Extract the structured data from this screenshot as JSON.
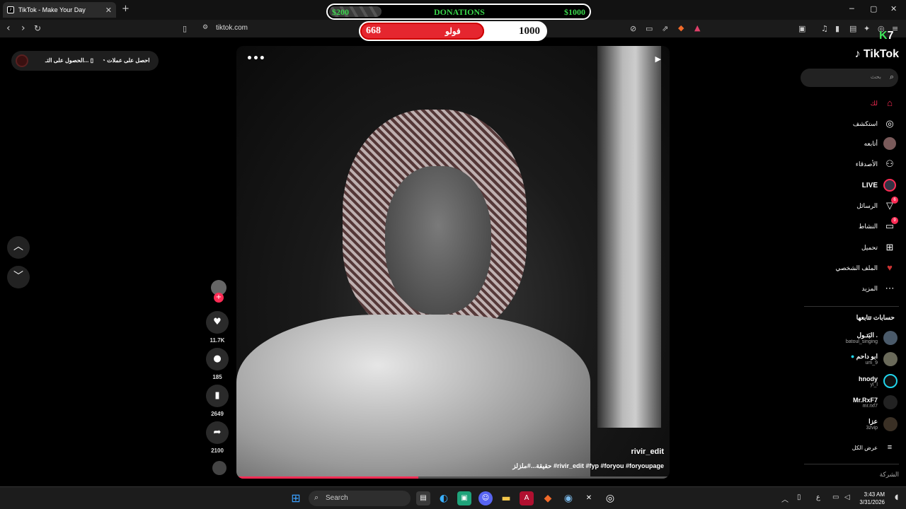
{
  "browser": {
    "tab_title": "TikTok - Make Your Day",
    "tab_close": "✕",
    "new_tab": "+",
    "url": "tiktok.com",
    "window_controls": [
      "─",
      "▢",
      "✕"
    ]
  },
  "overlay": {
    "donations": {
      "left_value": "$200",
      "title": "DONATIONS",
      "right_value": "$1000"
    },
    "followers": {
      "current": "668",
      "label": "فولو",
      "goal": "1000",
      "progress": 0.668
    },
    "corner_logo": "7"
  },
  "promo": {
    "item1": "احصل على عملات",
    "item2": "الحصول على التـ..."
  },
  "video": {
    "username": "rivir_edit",
    "caption": "حقيقة...#ملزلز #rivir_edit #fyp #foryou #foryoupage",
    "progress": 0.42
  },
  "actions": {
    "likes": "11.7K",
    "comments": "185",
    "saves": "2649",
    "shares": "2100"
  },
  "sidebar": {
    "logo": "TikTok",
    "search_placeholder": "بحث",
    "nav": [
      {
        "label": "لك",
        "icon": "home-icon"
      },
      {
        "label": "استكشف",
        "icon": "compass-icon"
      },
      {
        "label": "أتابعه",
        "icon": "following-icon"
      },
      {
        "label": "الأصدقاء",
        "icon": "friends-icon"
      },
      {
        "label": "LIVE",
        "icon": "live-icon"
      },
      {
        "label": "الرسائل",
        "icon": "messages-icon",
        "badge": "6"
      },
      {
        "label": "النشاط",
        "icon": "activity-icon",
        "badge": "9"
      },
      {
        "label": "تحميل",
        "icon": "upload-icon"
      },
      {
        "label": "الملف الشخصي",
        "icon": "profile-icon"
      },
      {
        "label": "المزيد",
        "icon": "more-icon"
      }
    ],
    "following_title": "حسابات تتابعها",
    "following": [
      {
        "name": "البَتـول .",
        "handle": "batoul_singing"
      },
      {
        "name": "ابو داحم",
        "handle": "um_9"
      },
      {
        "name": "hnody",
        "handle": "yl_l"
      },
      {
        "name": "Mr.RxF7",
        "handle": "mr.rxf7"
      },
      {
        "name": "عزا",
        "handle": "3zvip"
      }
    ],
    "see_all": "عرض الكل",
    "company": "الشركة"
  },
  "taskbar": {
    "search": "Search",
    "time": "3:43 AM",
    "date": "3/31/2026",
    "lang": "ع"
  }
}
